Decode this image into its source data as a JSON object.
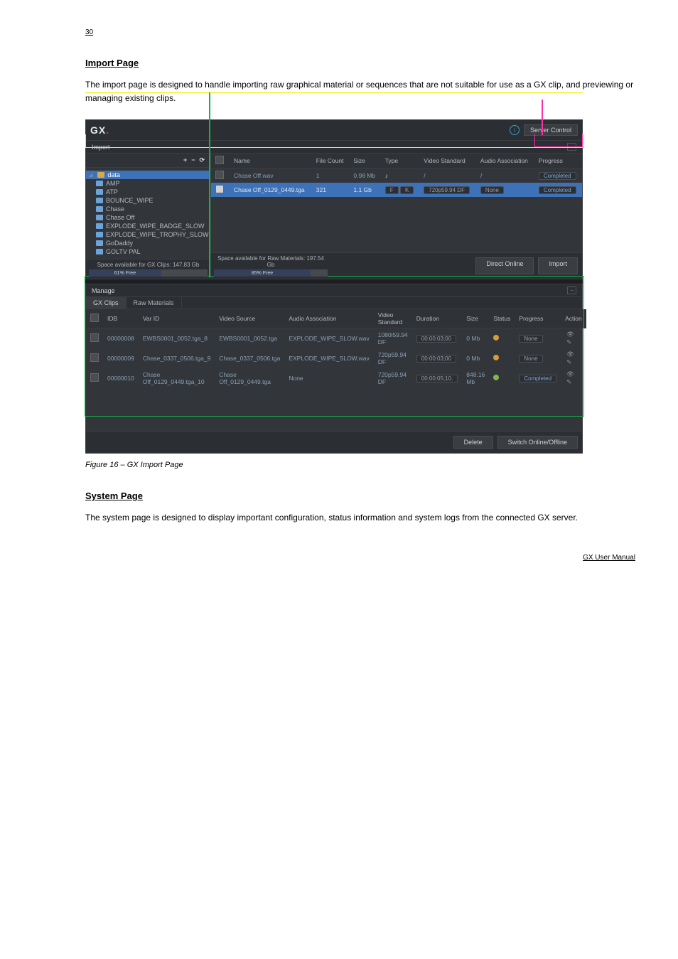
{
  "page_number_top": "30",
  "section_heading": "Import Page",
  "intro_para": "The import page is designed to handle importing raw graphical material or sequences that are not suitable for use as a GX clip, and previewing or managing existing clips.",
  "figure_caption": "Figure 16 – GX Import Page",
  "titlebar": {
    "brand": "GX",
    "info_button_title": "Info",
    "server_control": "Server Control"
  },
  "import": {
    "title": "Import",
    "toolbar": {
      "add": "+",
      "remove": "−",
      "refresh": "⟳"
    },
    "tree_root": "data",
    "tree_items": [
      "AMP",
      "ATP",
      "BOUNCE_WIPE",
      "Chase",
      "Chase Off",
      "EXPLODE_WIPE_BADGE_SLOW",
      "EXPLODE_WIPE_TROPHY_SLOW",
      "GoDaddy",
      "GOLTV PAL"
    ],
    "space_gx": "Space available for GX Clips: 147.83 Gb",
    "space_gx_pct": "61% Free",
    "space_raw": "Space available for Raw Materials: 197.54 Gb",
    "space_raw_pct": "85% Free",
    "columns": [
      "Name",
      "File Count",
      "Size",
      "Type",
      "Video Standard",
      "Audio Association",
      "Progress"
    ],
    "rows": [
      {
        "name": "Chase Off.wav",
        "file_count": "1",
        "size": "0.98 Mb",
        "type_icons": [
          "♪"
        ],
        "video_standard": "/",
        "audio_association": "/",
        "progress": "Completed",
        "selected": false
      },
      {
        "name": "Chase Off_0129_0449.tga",
        "file_count": "321",
        "size": "1.1 Gb",
        "type_icons": [
          "F",
          "K"
        ],
        "video_standard": "720p59.94 DF",
        "audio_association": "None",
        "progress": "Completed",
        "selected": true
      }
    ],
    "btn_direct_online": "Direct Online",
    "btn_import": "Import"
  },
  "manage": {
    "title": "Manage",
    "tabs": [
      "GX Clips",
      "Raw Materials"
    ],
    "columns": [
      "IDB",
      "Var ID",
      "Video Source",
      "Audio Association",
      "Video Standard",
      "Duration",
      "Size",
      "Status",
      "Progress",
      "Action"
    ],
    "rows": [
      {
        "idb": "00000008",
        "var": "EWBS0001_0052.tga_8",
        "src": "EWBS0001_0052.tga",
        "audio": "EXPLODE_WIPE_SLOW.wav",
        "std": "1080i59.94 DF",
        "dur": "00:00:03;00",
        "size": "0 Mb",
        "status": "org",
        "progress": "None"
      },
      {
        "idb": "00000009",
        "var": "Chase_0337_0506.tga_9",
        "src": "Chase_0337_0506.tga",
        "audio": "EXPLODE_WIPE_SLOW.wav",
        "std": "720p59.94 DF",
        "dur": "00:00:03;00",
        "size": "0 Mb",
        "status": "org",
        "progress": "None"
      },
      {
        "idb": "00000010",
        "var": "Chase Off_0129_0449.tga_10",
        "src": "Chase Off_0129_0449.tga",
        "audio": "None",
        "std": "720p59.94 DF",
        "dur": "00:00:05;10.",
        "size": "848.16 Mb",
        "status": "grn",
        "progress": "Completed"
      }
    ],
    "btn_delete": "Delete",
    "btn_switch": "Switch Online/Offline"
  },
  "system_heading": "System Page",
  "system_para": "The system page is designed to display important configuration, status information and system logs from the connected GX server.",
  "footer_right": "GX User Manual"
}
